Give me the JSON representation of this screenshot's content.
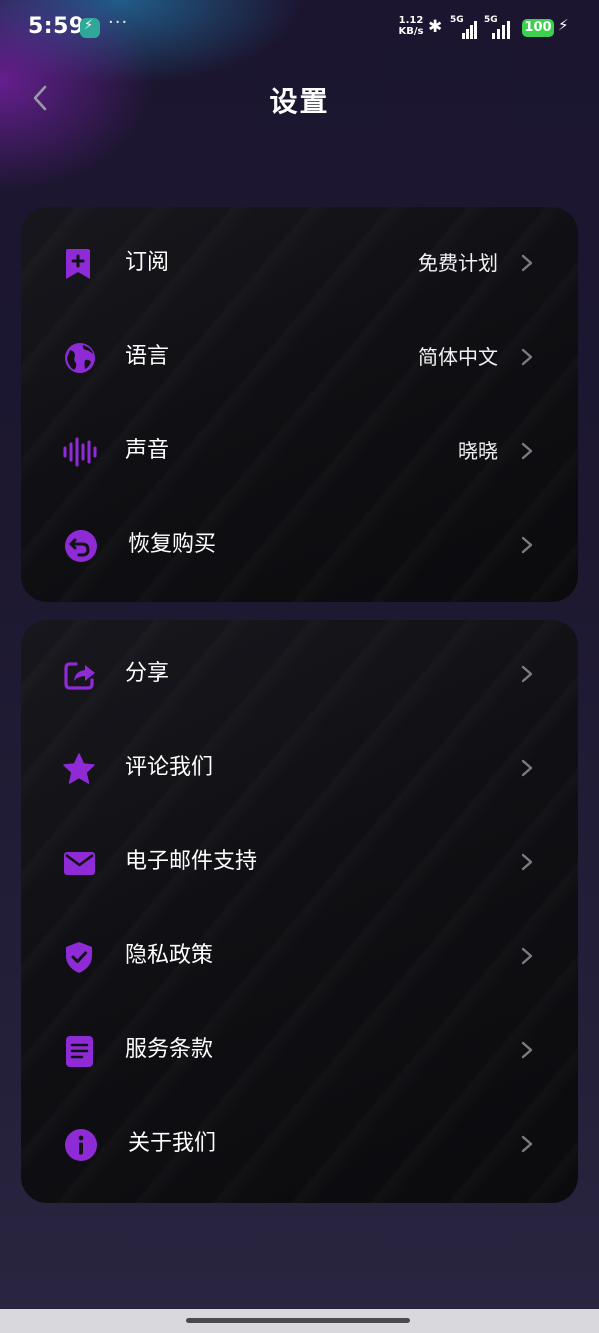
{
  "status_bar": {
    "time": "5:59",
    "speed_value": "1.12",
    "speed_unit": "KB/s",
    "network1": "5G",
    "network2": "5G",
    "battery": "100",
    "more": "···"
  },
  "header": {
    "title": "设置"
  },
  "colors": {
    "accent": "#8e2bd6",
    "card_bg": "#111116",
    "chevron": "#7a7a80"
  },
  "section1": {
    "items": [
      {
        "icon": "bookmark-plus-icon",
        "label": "订阅",
        "value": "免费计划"
      },
      {
        "icon": "globe-icon",
        "label": "语言",
        "value": "简体中文"
      },
      {
        "icon": "soundwave-icon",
        "label": "声音",
        "value": "晓晓"
      },
      {
        "icon": "restore-icon",
        "label": "恢复购买",
        "value": ""
      }
    ]
  },
  "section2": {
    "items": [
      {
        "icon": "share-icon",
        "label": "分享"
      },
      {
        "icon": "star-icon",
        "label": "评论我们"
      },
      {
        "icon": "mail-icon",
        "label": "电子邮件支持"
      },
      {
        "icon": "shield-check-icon",
        "label": "隐私政策"
      },
      {
        "icon": "document-icon",
        "label": "服务条款"
      },
      {
        "icon": "info-icon",
        "label": "关于我们"
      }
    ]
  }
}
